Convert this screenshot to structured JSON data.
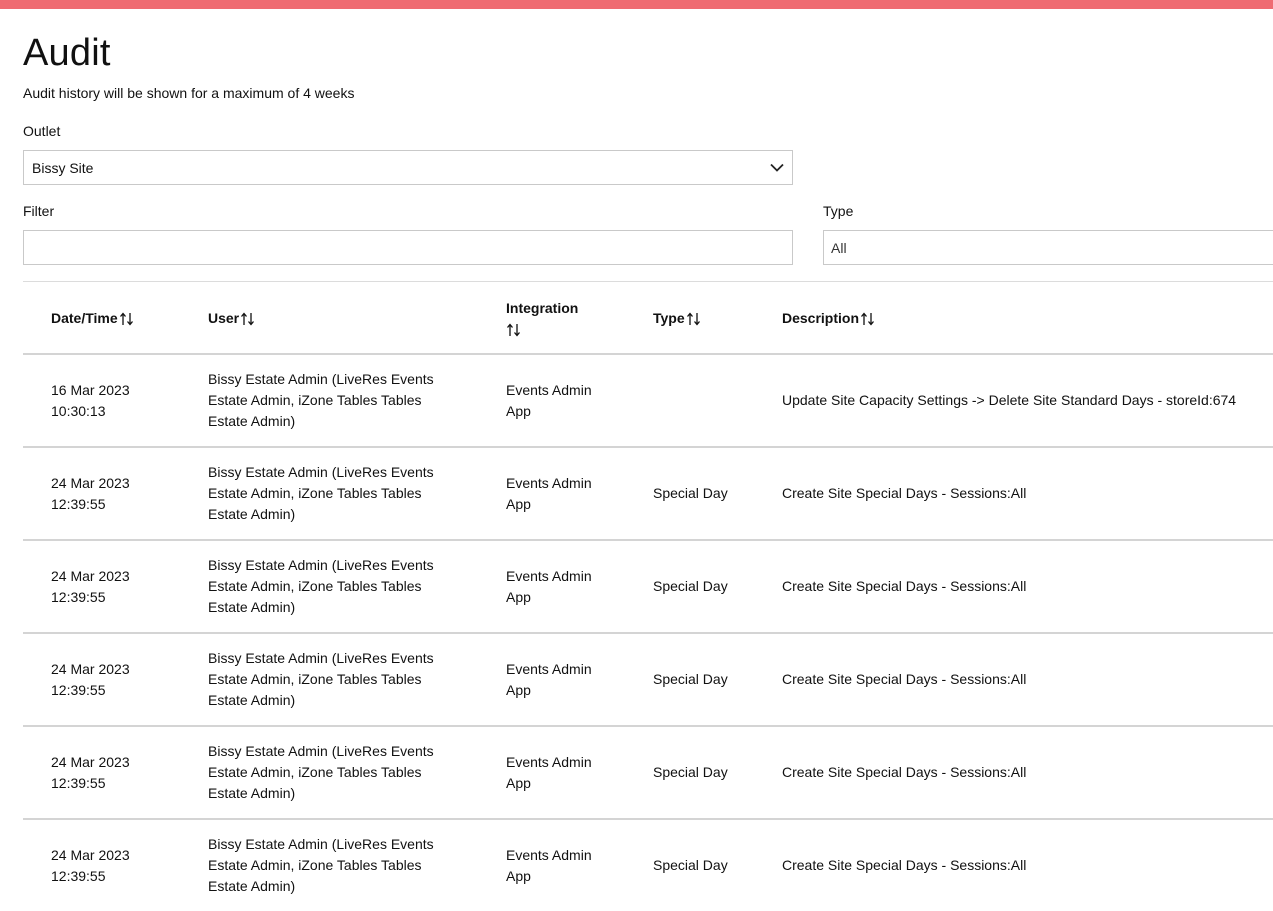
{
  "page": {
    "title": "Audit",
    "subtitle": "Audit history will be shown for a maximum of 4 weeks"
  },
  "accent_color": "#ef6b72",
  "outlet": {
    "label": "Outlet",
    "value": "Bissy Site",
    "icon": "chevron-down-icon"
  },
  "filter": {
    "label": "Filter",
    "value": "",
    "placeholder": ""
  },
  "type_filter": {
    "label": "Type",
    "value": "All"
  },
  "table": {
    "columns": [
      {
        "label": "Date/Time",
        "sort_icon": "sort-icon"
      },
      {
        "label": "User",
        "sort_icon": "sort-icon"
      },
      {
        "label": "Integration",
        "sort_icon": "sort-icon"
      },
      {
        "label": "Type",
        "sort_icon": "sort-icon"
      },
      {
        "label": "Description",
        "sort_icon": "sort-icon"
      }
    ],
    "rows": [
      {
        "date": "16 Mar 2023",
        "time": "10:30:13",
        "user": "Bissy Estate Admin (LiveRes Events Estate Admin, iZone Tables Tables Estate Admin)",
        "integration": "Events Admin App",
        "type": "",
        "description": "Update Site Capacity Settings -> Delete Site Standard Days - storeId:674"
      },
      {
        "date": "24 Mar 2023",
        "time": "12:39:55",
        "user": "Bissy Estate Admin (LiveRes Events Estate Admin, iZone Tables Tables Estate Admin)",
        "integration": "Events Admin App",
        "type": "Special Day",
        "description": "Create Site Special Days - Sessions:All"
      },
      {
        "date": "24 Mar 2023",
        "time": "12:39:55",
        "user": "Bissy Estate Admin (LiveRes Events Estate Admin, iZone Tables Tables Estate Admin)",
        "integration": "Events Admin App",
        "type": "Special Day",
        "description": "Create Site Special Days - Sessions:All"
      },
      {
        "date": "24 Mar 2023",
        "time": "12:39:55",
        "user": "Bissy Estate Admin (LiveRes Events Estate Admin, iZone Tables Tables Estate Admin)",
        "integration": "Events Admin App",
        "type": "Special Day",
        "description": "Create Site Special Days - Sessions:All"
      },
      {
        "date": "24 Mar 2023",
        "time": "12:39:55",
        "user": "Bissy Estate Admin (LiveRes Events Estate Admin, iZone Tables Tables Estate Admin)",
        "integration": "Events Admin App",
        "type": "Special Day",
        "description": "Create Site Special Days - Sessions:All"
      },
      {
        "date": "24 Mar 2023",
        "time": "12:39:55",
        "user": "Bissy Estate Admin (LiveRes Events Estate Admin, iZone Tables Tables Estate Admin)",
        "integration": "Events Admin App",
        "type": "Special Day",
        "description": "Create Site Special Days - Sessions:All"
      }
    ]
  }
}
